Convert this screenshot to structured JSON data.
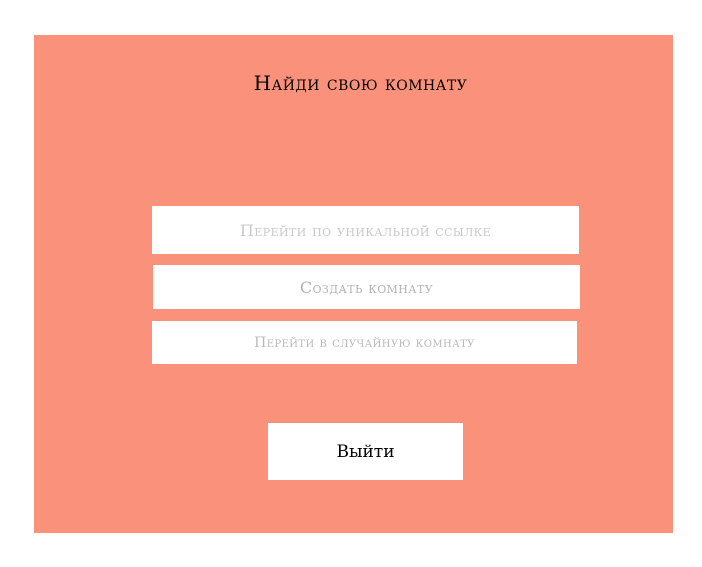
{
  "page": {
    "title": "Найди свою комнату"
  },
  "menu": {
    "unique_link_label": "Перейти по уникальной ссылке",
    "create_room_label": "Создать комнату",
    "random_room_label": "Перейти в случайную комнату"
  },
  "footer": {
    "exit_label": "Выйти"
  },
  "colors": {
    "panel_background": "#fa917b",
    "page_background": "#ffffff",
    "button_background": "#ffffff",
    "button_text_muted": "#c9c9c9",
    "exit_text": "#000000"
  }
}
